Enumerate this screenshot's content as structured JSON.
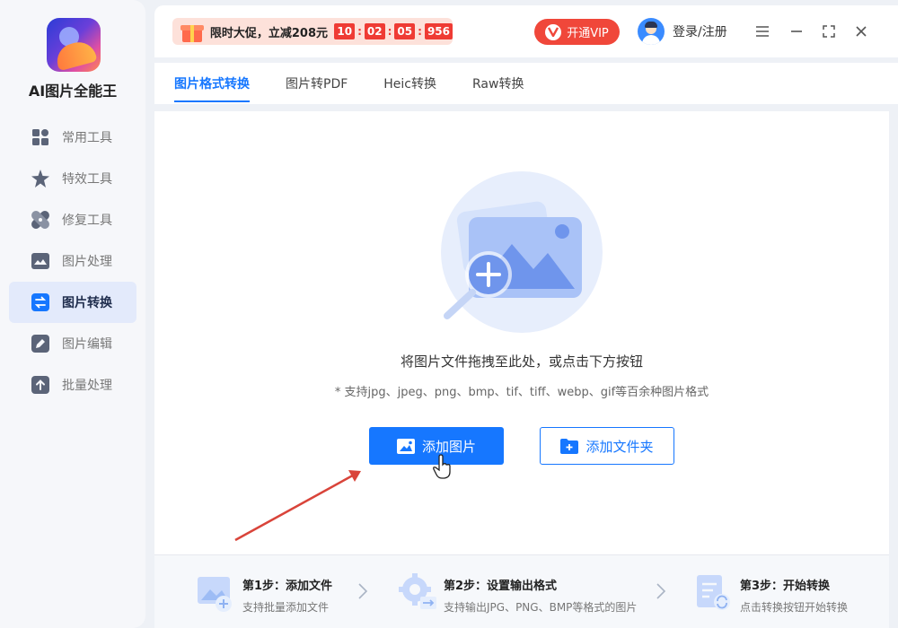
{
  "app": {
    "name": "AI图片全能王"
  },
  "sidebar": {
    "items": [
      {
        "label": "常用工具",
        "icon": "grid-icon",
        "active": false
      },
      {
        "label": "特效工具",
        "icon": "star-icon",
        "active": false
      },
      {
        "label": "修复工具",
        "icon": "bandage-icon",
        "active": false
      },
      {
        "label": "图片处理",
        "icon": "image-icon",
        "active": false
      },
      {
        "label": "图片转换",
        "icon": "convert-icon",
        "active": true
      },
      {
        "label": "图片编辑",
        "icon": "edit-icon",
        "active": false
      },
      {
        "label": "批量处理",
        "icon": "upload-icon",
        "active": false
      }
    ]
  },
  "header": {
    "promo_text": "限时大促，立减208元",
    "timer": {
      "hours": "10",
      "minutes": "02",
      "seconds": "05",
      "ms": "956"
    },
    "vip_label": "开通VIP",
    "login_label": "登录/注册"
  },
  "tabs": [
    {
      "label": "图片格式转换",
      "active": true
    },
    {
      "label": "图片转PDF",
      "active": false
    },
    {
      "label": "Heic转换",
      "active": false
    },
    {
      "label": "Raw转换",
      "active": false
    }
  ],
  "main": {
    "drop_text": "将图片文件拖拽至此处，或点击下方按钮",
    "support_text": "* 支持jpg、jpeg、png、bmp、tif、tiff、webp、gif等百余种图片格式",
    "add_image_label": "添加图片",
    "add_folder_label": "添加文件夹"
  },
  "steps": [
    {
      "title": "第1步：添加文件",
      "desc": "支持批量添加文件"
    },
    {
      "title": "第2步：设置输出格式",
      "desc": "支持输出JPG、PNG、BMP等格式的图片"
    },
    {
      "title": "第3步：开始转换",
      "desc": "点击转换按钮开始转换"
    }
  ],
  "colors": {
    "accent": "#1677ff",
    "vip": "#f0473a",
    "promo_bg": "#fde1da",
    "sidebar_active": "#e3eafb"
  }
}
